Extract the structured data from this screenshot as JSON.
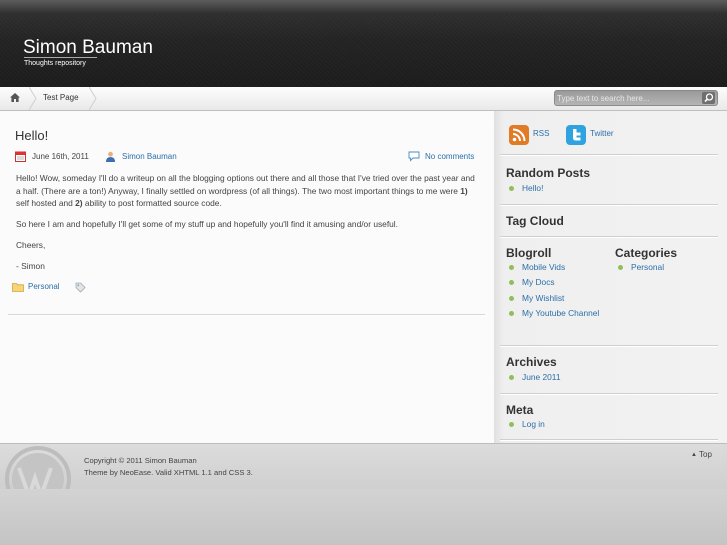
{
  "header": {
    "site_title": "Simon Bauman",
    "site_description": "Thoughts repository"
  },
  "nav": {
    "home_icon": "home-icon",
    "pages": [
      "Test Page"
    ]
  },
  "search": {
    "placeholder": "Type text to search here...",
    "button_icon": "search-icon"
  },
  "post": {
    "title": "Hello!",
    "date": "June 16th, 2011",
    "author": "Simon Bauman",
    "comments": "No comments",
    "paragraph1_a": "Hello!  Wow, someday I'll do a writeup on all the blogging options out there and all those that I've tried over the past year and a half.  (There are a ton!)  Anyway, I finally settled on wordpress (of all things). The two most important things to me were ",
    "bold1": "1)",
    "paragraph1_b": " self hosted and ",
    "bold2": "2)",
    "paragraph1_c": " ability to post formatted source code.",
    "paragraph2": "So here I am and hopefully I'll get some of my stuff up and hopefully you'll find it amusing and/or useful.",
    "paragraph3": "Cheers,",
    "paragraph4": "- Simon",
    "category": "Personal"
  },
  "sidebar": {
    "rss_label": "RSS",
    "twitter_label": "Twitter",
    "random_posts": {
      "title": "Random Posts",
      "items": [
        "Hello!"
      ]
    },
    "tag_cloud": {
      "title": "Tag Cloud"
    },
    "blogroll": {
      "title": "Blogroll",
      "items": [
        "Mobile Vids",
        "My Docs",
        "My Wishlist",
        "My Youtube Channel"
      ]
    },
    "categories": {
      "title": "Categories",
      "items": [
        "Personal"
      ]
    },
    "archives": {
      "title": "Archives",
      "items": [
        "June 2011"
      ]
    },
    "meta": {
      "title": "Meta",
      "items": [
        "Log in"
      ]
    }
  },
  "footer": {
    "copyright": "Copyright © 2011 Simon Bauman",
    "theme_by": "Theme by ",
    "theme_name": "NeoEase",
    "valid_text": ". Valid ",
    "xhtml": "XHTML 1.1",
    "and_text": " and ",
    "css": "CSS 3",
    "period": ".",
    "top_link": "Top"
  },
  "colors": {
    "link": "#2c6fa8",
    "header_bg": "#232323",
    "bullet": "#8fbf5a",
    "rss_orange": "#e07b26",
    "twitter_blue": "#2fa3e0"
  }
}
